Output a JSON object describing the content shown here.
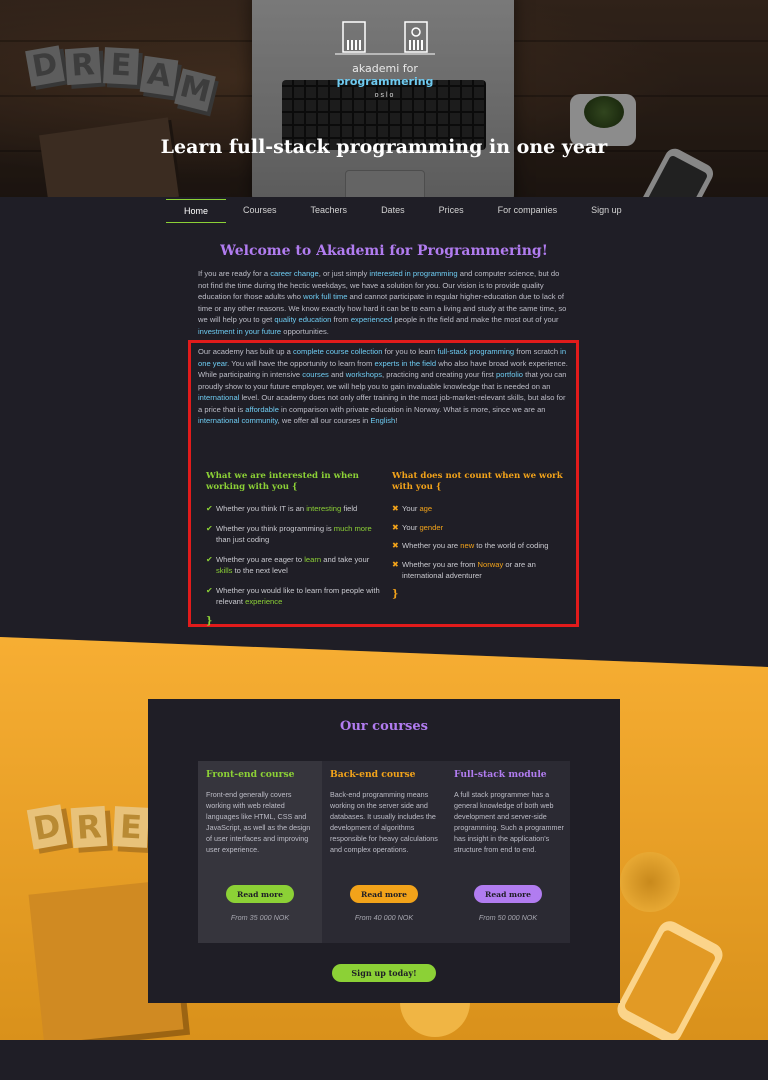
{
  "hero": {
    "logo_prefix": "akademi for ",
    "logo_strong": "programmering",
    "logo_sub": "oslo",
    "title": "Learn full-stack programming in one year",
    "dream_letters": [
      "D",
      "R",
      "E",
      "A",
      "M"
    ]
  },
  "nav": {
    "items": [
      "Home",
      "Courses",
      "Teachers",
      "Dates",
      "Prices",
      "For companies",
      "Sign up"
    ],
    "active": "Home"
  },
  "welcome": {
    "title": "Welcome to Akademi for Programmering!",
    "p1": [
      {
        "t": "If you are ready for a "
      },
      {
        "t": "career change",
        "hl": true
      },
      {
        "t": ", or just simply "
      },
      {
        "t": "interested in programming",
        "hl": true
      },
      {
        "t": " and computer science, but do not find the time during the hectic weekdays, we have a solution for you. Our vision is to provide quality education for those adults who "
      },
      {
        "t": "work full time",
        "hl": true
      },
      {
        "t": " and cannot participate in regular higher-education due to lack of time or any other reasons. We know exactly how hard it can be to earn a living and study at the same time, so we will help you to get "
      },
      {
        "t": "quality education",
        "hl": true
      },
      {
        "t": " from "
      },
      {
        "t": "experienced",
        "hl": true
      },
      {
        "t": " people in the field and make the most out of your "
      },
      {
        "t": "investment in your future",
        "hl": true
      },
      {
        "t": " opportunities."
      }
    ],
    "p2": [
      {
        "t": "Our academy has built up a "
      },
      {
        "t": "complete course collection",
        "hl": true
      },
      {
        "t": " for you to learn "
      },
      {
        "t": "full-stack programming",
        "hl": true
      },
      {
        "t": " from scratch "
      },
      {
        "t": "in one year",
        "hl": true
      },
      {
        "t": ". You will have the opportunity to learn from "
      },
      {
        "t": "experts in the field",
        "hl": true
      },
      {
        "t": " who also have broad work experience. While participating in intensive "
      },
      {
        "t": "courses",
        "hl": true
      },
      {
        "t": " and "
      },
      {
        "t": "workshops",
        "hl": true
      },
      {
        "t": ", practicing and creating your first "
      },
      {
        "t": "portfolio",
        "hl": true
      },
      {
        "t": " that you can proudly show to your future employer, we will help you to gain invaluable knowledge that is needed on an "
      },
      {
        "t": "international",
        "hl": true
      },
      {
        "t": " level. Our academy does not only offer training in the most job-market-relevant skills, but also for a price that is "
      },
      {
        "t": "affordable",
        "hl": true
      },
      {
        "t": " in comparison with private education in Norway. What is more, since we are an "
      },
      {
        "t": "international community",
        "hl": true
      },
      {
        "t": ", we offer all our courses in "
      },
      {
        "t": "English",
        "hl": true
      },
      {
        "t": "!"
      }
    ]
  },
  "interested": {
    "title": "What we are interested in when working with you {",
    "items": [
      [
        {
          "t": "Whether you think IT is an "
        },
        {
          "t": "interesting",
          "kw": true
        },
        {
          "t": " field"
        }
      ],
      [
        {
          "t": "Whether you think programming is "
        },
        {
          "t": "much more",
          "kw": true
        },
        {
          "t": " than just coding"
        }
      ],
      [
        {
          "t": "Whether you are eager to "
        },
        {
          "t": "learn",
          "kw": true
        },
        {
          "t": " and take your "
        },
        {
          "t": "skills",
          "kw": true
        },
        {
          "t": " to the next level"
        }
      ],
      [
        {
          "t": "Whether you would like to learn from people with relevant "
        },
        {
          "t": "experience",
          "kw": true
        }
      ]
    ],
    "close": "}"
  },
  "not_count": {
    "title": "What does not count when we work with you {",
    "items": [
      [
        {
          "t": "Your "
        },
        {
          "t": "age",
          "kw": true
        }
      ],
      [
        {
          "t": "Your "
        },
        {
          "t": "gender",
          "kw": true
        }
      ],
      [
        {
          "t": "Whether you are "
        },
        {
          "t": "new",
          "kw": true
        },
        {
          "t": " to the world of coding"
        }
      ],
      [
        {
          "t": "Whether you are from "
        },
        {
          "t": "Norway",
          "kw": true
        },
        {
          "t": " or are an international adventurer"
        }
      ]
    ],
    "close": "}"
  },
  "courses": {
    "title": "Our courses",
    "items": [
      {
        "title": "Front-end course",
        "desc": "Front-end generally covers working with web related languages like HTML, CSS and JavaScript, as well as the design of user interfaces and improving user experience.",
        "button": "Read more",
        "price": "From 35 000 NOK"
      },
      {
        "title": "Back-end course",
        "desc": "Back-end programming means working on the server side and databases. It usually includes the development of algorithms responsible for heavy calculations and complex operations.",
        "button": "Read more",
        "price": "From 40 000 NOK"
      },
      {
        "title": "Full-stack module",
        "desc": "A full stack programmer has a general knowledge of both web development and server-side programming. Such a programmer has insight in the application's structure from end to end.",
        "button": "Read more",
        "price": "From 50 000 NOK"
      }
    ],
    "signup": "Sign up today!"
  },
  "colors": {
    "green": "#8cd136",
    "orange": "#f2a31a",
    "purple": "#b17cf0",
    "blue": "#6ecbf1",
    "dark": "#1f1e26",
    "highlight": "#e11b1b"
  },
  "icons": {
    "check": "check-icon",
    "cross": "cross-icon"
  }
}
